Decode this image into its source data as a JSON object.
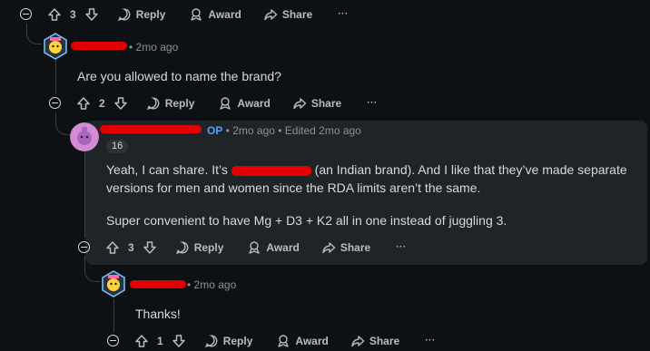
{
  "actions": {
    "reply": "Reply",
    "award": "Award",
    "share": "Share",
    "more": "···"
  },
  "top_bar": {
    "votes": "3"
  },
  "c1": {
    "time": "2mo ago",
    "text": "Are you allowed to name the brand?",
    "votes": "2"
  },
  "c2": {
    "op": "OP",
    "time": "2mo ago",
    "edited": "Edited 2mo ago",
    "flair": "16",
    "p1a": "Yeah, I can share. It’s ",
    "p1b": " (an Indian brand). And I like that they’ve made separate versions for men and women since the RDA limits aren’t the same.",
    "p2": "Super convenient to have Mg + D3 + K2 all in one instead of juggling 3.",
    "votes": "3"
  },
  "c3": {
    "time": "2mo ago",
    "text": "Thanks!",
    "votes": "1"
  },
  "colors": {
    "bg": "#0e1113",
    "highlight": "#1f2428",
    "op": "#5a9bff",
    "redaction": "#e30000"
  }
}
